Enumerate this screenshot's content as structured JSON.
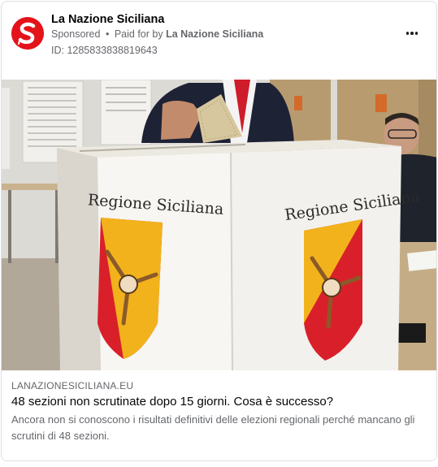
{
  "ad": {
    "page_name": "La Nazione Siciliana",
    "sponsored_label": "Sponsored",
    "separator": "•",
    "paid_for_prefix": "Paid for by",
    "paid_for_by": "La Nazione Siciliana",
    "id_label": "ID: 1285833838819643",
    "more_icon": "more-horizontal-icon"
  },
  "media": {
    "box_text_left": "Regione Siciliana",
    "box_text_right": "Regione Siciliana",
    "colors": {
      "emblem_red": "#d9202a",
      "emblem_yellow": "#f2b21b",
      "logo_red": "#e4131a"
    }
  },
  "link": {
    "domain": "LANAZIONESICILIANA.EU",
    "headline": "48 sezioni non scrutinate dopo 15 giorni. Cosa è successo?",
    "description": "Ancora non si conoscono i risultati definitivi delle elezioni regionali perché mancano gli scrutini di 48 sezioni."
  }
}
